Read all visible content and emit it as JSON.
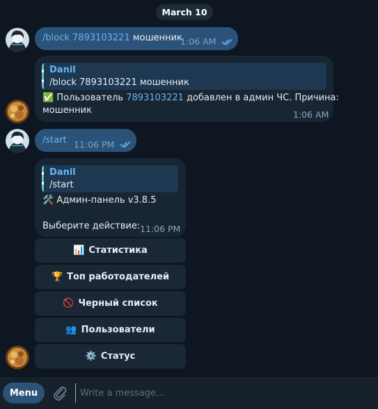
{
  "date_chip": "March 10",
  "messages": {
    "m1": {
      "command": "/block",
      "id": "7893103221",
      "rest": " мошенник",
      "time": "1:06 AM"
    },
    "m2": {
      "reply_name": "Danil",
      "reply_text": "/block 7893103221 мошенник",
      "emoji": "✅",
      "line1_prefix": " Пользователь ",
      "line1_id": "7893103221",
      "line1_suffix": " добавлен в админ ЧС. Причина:",
      "line2": "мошенник",
      "time": "1:06 AM"
    },
    "m3": {
      "command": "/start",
      "time": "11:06 PM"
    },
    "m4": {
      "reply_name": "Danil",
      "reply_text": "/start",
      "emoji": "🛠️",
      "line1": " Админ-панель v3.8.5",
      "line2": "Выберите действие:",
      "time": "11:06 PM"
    }
  },
  "keyboard": [
    {
      "emoji": "📊",
      "label": "Статистика"
    },
    {
      "emoji": "🏆",
      "label": "Топ работодателей"
    },
    {
      "emoji": "🚫",
      "label": "Черный список"
    },
    {
      "emoji": "👥",
      "label": "Пользователи"
    },
    {
      "emoji": "⚙️",
      "label": "Статус"
    }
  ],
  "composer": {
    "menu_label": "Menu",
    "placeholder": "Write a message..."
  },
  "icons": {
    "read_ticks": "double-check-icon",
    "attach": "paperclip-icon"
  }
}
